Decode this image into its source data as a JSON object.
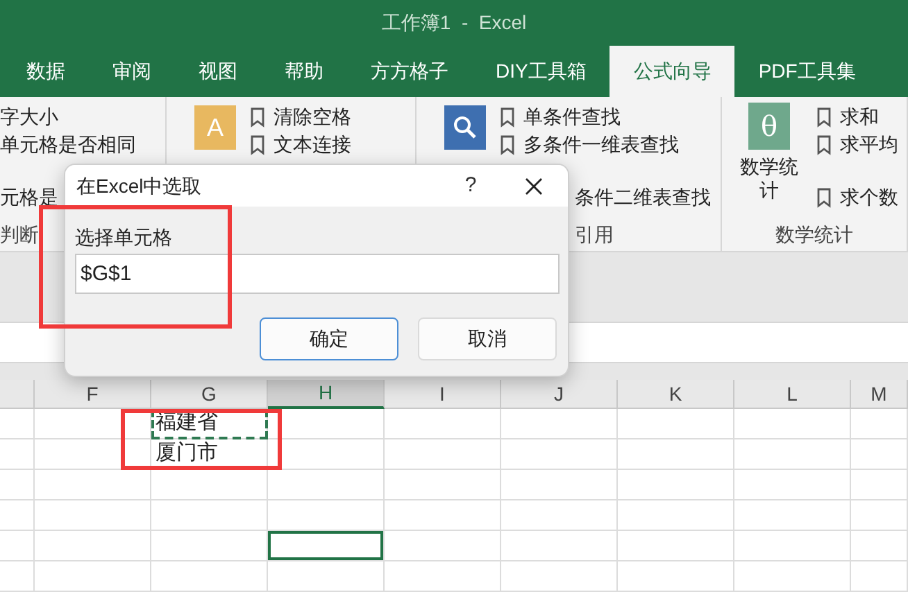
{
  "window": {
    "title": "工作簿1  -  Excel"
  },
  "tabs": [
    {
      "label": "数据",
      "selected": false
    },
    {
      "label": "审阅",
      "selected": false
    },
    {
      "label": "视图",
      "selected": false
    },
    {
      "label": "帮助",
      "selected": false
    },
    {
      "label": "方方格子",
      "selected": false
    },
    {
      "label": "DIY工具箱",
      "selected": false
    },
    {
      "label": "公式向导",
      "selected": true
    },
    {
      "label": "PDF工具集",
      "selected": false
    }
  ],
  "ribbon": {
    "groups": [
      {
        "kind": "list",
        "items": [
          "字大小",
          "单元格是否相同",
          "元格是"
        ],
        "label": "判断"
      },
      {
        "kind": "letter",
        "icon_text": "A",
        "items": [
          "清除空格",
          "文本连接"
        ]
      },
      {
        "kind": "search",
        "items": [
          "单条件查找",
          "多条件一维表查找",
          "条件二维表查找"
        ],
        "label": "引用"
      },
      {
        "kind": "stat",
        "icon_text": "θ",
        "button": "数学统计",
        "items": [
          "求和",
          "求平均",
          "求个数"
        ],
        "label": "数学统计"
      }
    ]
  },
  "dialog": {
    "title": "在Excel中选取",
    "help": "?",
    "field_label": "选择单元格",
    "value": "$G$1",
    "buttons": [
      {
        "label": "确定",
        "focused": true
      },
      {
        "label": "取消",
        "focused": false
      }
    ]
  },
  "sheet": {
    "columns": [
      {
        "label": "F",
        "selected": false
      },
      {
        "label": "G",
        "selected": false
      },
      {
        "label": "H",
        "selected": true
      },
      {
        "label": "I",
        "selected": false
      },
      {
        "label": "J",
        "selected": false
      },
      {
        "label": "K",
        "selected": false
      },
      {
        "label": "L",
        "selected": false
      },
      {
        "label": "M",
        "selected": false
      }
    ],
    "rows": [
      {
        "cells": [
          {
            "copied": false,
            "active": false
          },
          {
            "text": "福建省",
            "copied": true,
            "active": false
          },
          {
            "copied": false,
            "active": false
          },
          {
            "copied": false,
            "active": false
          },
          {
            "copied": false,
            "active": false
          },
          {
            "copied": false,
            "active": false
          },
          {
            "copied": false,
            "active": false
          },
          {
            "copied": false,
            "active": false
          }
        ]
      },
      {
        "cells": [
          {
            "copied": false,
            "active": false
          },
          {
            "text": "厦门市",
            "copied": false,
            "active": false
          },
          {
            "copied": false,
            "active": false
          },
          {
            "copied": false,
            "active": false
          },
          {
            "copied": false,
            "active": false
          },
          {
            "copied": false,
            "active": false
          },
          {
            "copied": false,
            "active": false
          },
          {
            "copied": false,
            "active": false
          }
        ]
      },
      {
        "cells": [
          {
            "copied": false,
            "active": false
          },
          {
            "copied": false,
            "active": false
          },
          {
            "copied": false,
            "active": false
          },
          {
            "copied": false,
            "active": false
          },
          {
            "copied": false,
            "active": false
          },
          {
            "copied": false,
            "active": false
          },
          {
            "copied": false,
            "active": false
          },
          {
            "copied": false,
            "active": false
          }
        ]
      },
      {
        "cells": [
          {
            "copied": false,
            "active": false
          },
          {
            "copied": false,
            "active": false
          },
          {
            "copied": false,
            "active": false
          },
          {
            "copied": false,
            "active": false
          },
          {
            "copied": false,
            "active": false
          },
          {
            "copied": false,
            "active": false
          },
          {
            "copied": false,
            "active": false
          },
          {
            "copied": false,
            "active": false
          }
        ]
      },
      {
        "cells": [
          {
            "copied": false,
            "active": false
          },
          {
            "copied": false,
            "active": false
          },
          {
            "copied": false,
            "active": true
          },
          {
            "copied": false,
            "active": false
          },
          {
            "copied": false,
            "active": false
          },
          {
            "copied": false,
            "active": false
          },
          {
            "copied": false,
            "active": false
          },
          {
            "copied": false,
            "active": false
          }
        ]
      },
      {
        "cells": [
          {
            "copied": false,
            "active": false
          },
          {
            "copied": false,
            "active": false
          },
          {
            "copied": false,
            "active": false
          },
          {
            "copied": false,
            "active": false
          },
          {
            "copied": false,
            "active": false
          },
          {
            "copied": false,
            "active": false
          },
          {
            "copied": false,
            "active": false
          },
          {
            "copied": false,
            "active": false
          }
        ]
      }
    ]
  }
}
